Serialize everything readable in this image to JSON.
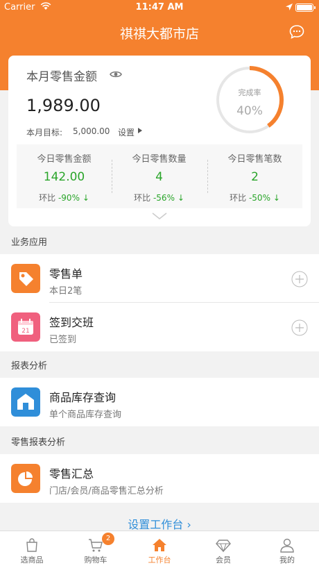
{
  "status_bar": {
    "carrier": "Carrier",
    "time": "11:47 AM"
  },
  "header": {
    "title": "祺祺大都市店"
  },
  "summary": {
    "label": "本月零售金额",
    "amount": "1,989.00",
    "target_label": "本月目标:",
    "target_value": "5,000.00",
    "setting_label": "设置",
    "completion_label": "完成率",
    "completion_value": "40%",
    "completion_fraction": 0.4
  },
  "stats": [
    {
      "label": "今日零售金额",
      "value": "142.00",
      "change_label": "环比",
      "change": "-90%"
    },
    {
      "label": "今日零售数量",
      "value": "4",
      "change_label": "环比",
      "change": "-56%"
    },
    {
      "label": "今日零售笔数",
      "value": "2",
      "change_label": "环比",
      "change": "-50%"
    }
  ],
  "sections": {
    "business": {
      "title": "业务应用",
      "items": [
        {
          "title": "零售单",
          "subtitle": "本日2笔"
        },
        {
          "title": "签到交班",
          "subtitle": "已签到"
        }
      ]
    },
    "reports": {
      "title": "报表分析",
      "items": [
        {
          "title": "商品库存查询",
          "subtitle": "单个商品库存查询"
        }
      ]
    },
    "retail_reports": {
      "title": "零售报表分析",
      "items": [
        {
          "title": "零售汇总",
          "subtitle": "门店/会员/商品零售汇总分析"
        }
      ]
    }
  },
  "setup_link": "设置工作台",
  "calendar_day": "21",
  "tabbar": {
    "cart_badge": "2",
    "tabs": [
      {
        "label": "选商品",
        "icon": "shopping-bag-icon"
      },
      {
        "label": "购物车",
        "icon": "cart-icon"
      },
      {
        "label": "工作台",
        "icon": "home-icon"
      },
      {
        "label": "会员",
        "icon": "diamond-icon"
      },
      {
        "label": "我的",
        "icon": "person-icon"
      }
    ]
  },
  "colors": {
    "accent": "#f5812e",
    "positive": "#2aa52a",
    "link": "#2f8ed9"
  }
}
